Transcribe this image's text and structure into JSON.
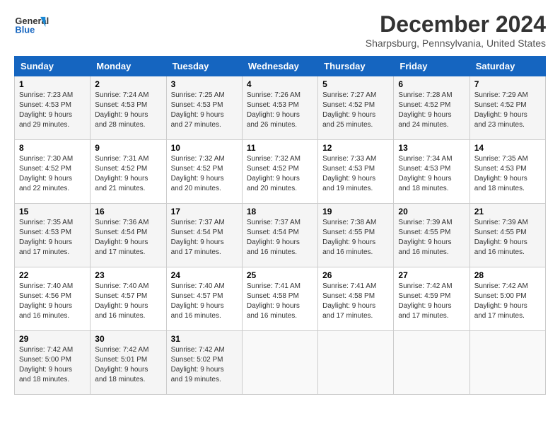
{
  "header": {
    "logo_line1": "General",
    "logo_line2": "Blue",
    "month": "December 2024",
    "location": "Sharpsburg, Pennsylvania, United States"
  },
  "days_of_week": [
    "Sunday",
    "Monday",
    "Tuesday",
    "Wednesday",
    "Thursday",
    "Friday",
    "Saturday"
  ],
  "weeks": [
    [
      {
        "day": "1",
        "rise": "Sunrise: 7:23 AM",
        "set": "Sunset: 4:53 PM",
        "daylight": "Daylight: 9 hours and 29 minutes."
      },
      {
        "day": "2",
        "rise": "Sunrise: 7:24 AM",
        "set": "Sunset: 4:53 PM",
        "daylight": "Daylight: 9 hours and 28 minutes."
      },
      {
        "day": "3",
        "rise": "Sunrise: 7:25 AM",
        "set": "Sunset: 4:53 PM",
        "daylight": "Daylight: 9 hours and 27 minutes."
      },
      {
        "day": "4",
        "rise": "Sunrise: 7:26 AM",
        "set": "Sunset: 4:53 PM",
        "daylight": "Daylight: 9 hours and 26 minutes."
      },
      {
        "day": "5",
        "rise": "Sunrise: 7:27 AM",
        "set": "Sunset: 4:52 PM",
        "daylight": "Daylight: 9 hours and 25 minutes."
      },
      {
        "day": "6",
        "rise": "Sunrise: 7:28 AM",
        "set": "Sunset: 4:52 PM",
        "daylight": "Daylight: 9 hours and 24 minutes."
      },
      {
        "day": "7",
        "rise": "Sunrise: 7:29 AM",
        "set": "Sunset: 4:52 PM",
        "daylight": "Daylight: 9 hours and 23 minutes."
      }
    ],
    [
      {
        "day": "8",
        "rise": "Sunrise: 7:30 AM",
        "set": "Sunset: 4:52 PM",
        "daylight": "Daylight: 9 hours and 22 minutes."
      },
      {
        "day": "9",
        "rise": "Sunrise: 7:31 AM",
        "set": "Sunset: 4:52 PM",
        "daylight": "Daylight: 9 hours and 21 minutes."
      },
      {
        "day": "10",
        "rise": "Sunrise: 7:32 AM",
        "set": "Sunset: 4:52 PM",
        "daylight": "Daylight: 9 hours and 20 minutes."
      },
      {
        "day": "11",
        "rise": "Sunrise: 7:32 AM",
        "set": "Sunset: 4:52 PM",
        "daylight": "Daylight: 9 hours and 20 minutes."
      },
      {
        "day": "12",
        "rise": "Sunrise: 7:33 AM",
        "set": "Sunset: 4:53 PM",
        "daylight": "Daylight: 9 hours and 19 minutes."
      },
      {
        "day": "13",
        "rise": "Sunrise: 7:34 AM",
        "set": "Sunset: 4:53 PM",
        "daylight": "Daylight: 9 hours and 18 minutes."
      },
      {
        "day": "14",
        "rise": "Sunrise: 7:35 AM",
        "set": "Sunset: 4:53 PM",
        "daylight": "Daylight: 9 hours and 18 minutes."
      }
    ],
    [
      {
        "day": "15",
        "rise": "Sunrise: 7:35 AM",
        "set": "Sunset: 4:53 PM",
        "daylight": "Daylight: 9 hours and 17 minutes."
      },
      {
        "day": "16",
        "rise": "Sunrise: 7:36 AM",
        "set": "Sunset: 4:54 PM",
        "daylight": "Daylight: 9 hours and 17 minutes."
      },
      {
        "day": "17",
        "rise": "Sunrise: 7:37 AM",
        "set": "Sunset: 4:54 PM",
        "daylight": "Daylight: 9 hours and 17 minutes."
      },
      {
        "day": "18",
        "rise": "Sunrise: 7:37 AM",
        "set": "Sunset: 4:54 PM",
        "daylight": "Daylight: 9 hours and 16 minutes."
      },
      {
        "day": "19",
        "rise": "Sunrise: 7:38 AM",
        "set": "Sunset: 4:55 PM",
        "daylight": "Daylight: 9 hours and 16 minutes."
      },
      {
        "day": "20",
        "rise": "Sunrise: 7:39 AM",
        "set": "Sunset: 4:55 PM",
        "daylight": "Daylight: 9 hours and 16 minutes."
      },
      {
        "day": "21",
        "rise": "Sunrise: 7:39 AM",
        "set": "Sunset: 4:55 PM",
        "daylight": "Daylight: 9 hours and 16 minutes."
      }
    ],
    [
      {
        "day": "22",
        "rise": "Sunrise: 7:40 AM",
        "set": "Sunset: 4:56 PM",
        "daylight": "Daylight: 9 hours and 16 minutes."
      },
      {
        "day": "23",
        "rise": "Sunrise: 7:40 AM",
        "set": "Sunset: 4:57 PM",
        "daylight": "Daylight: 9 hours and 16 minutes."
      },
      {
        "day": "24",
        "rise": "Sunrise: 7:40 AM",
        "set": "Sunset: 4:57 PM",
        "daylight": "Daylight: 9 hours and 16 minutes."
      },
      {
        "day": "25",
        "rise": "Sunrise: 7:41 AM",
        "set": "Sunset: 4:58 PM",
        "daylight": "Daylight: 9 hours and 16 minutes."
      },
      {
        "day": "26",
        "rise": "Sunrise: 7:41 AM",
        "set": "Sunset: 4:58 PM",
        "daylight": "Daylight: 9 hours and 17 minutes."
      },
      {
        "day": "27",
        "rise": "Sunrise: 7:42 AM",
        "set": "Sunset: 4:59 PM",
        "daylight": "Daylight: 9 hours and 17 minutes."
      },
      {
        "day": "28",
        "rise": "Sunrise: 7:42 AM",
        "set": "Sunset: 5:00 PM",
        "daylight": "Daylight: 9 hours and 17 minutes."
      }
    ],
    [
      {
        "day": "29",
        "rise": "Sunrise: 7:42 AM",
        "set": "Sunset: 5:00 PM",
        "daylight": "Daylight: 9 hours and 18 minutes."
      },
      {
        "day": "30",
        "rise": "Sunrise: 7:42 AM",
        "set": "Sunset: 5:01 PM",
        "daylight": "Daylight: 9 hours and 18 minutes."
      },
      {
        "day": "31",
        "rise": "Sunrise: 7:42 AM",
        "set": "Sunset: 5:02 PM",
        "daylight": "Daylight: 9 hours and 19 minutes."
      },
      null,
      null,
      null,
      null
    ]
  ]
}
